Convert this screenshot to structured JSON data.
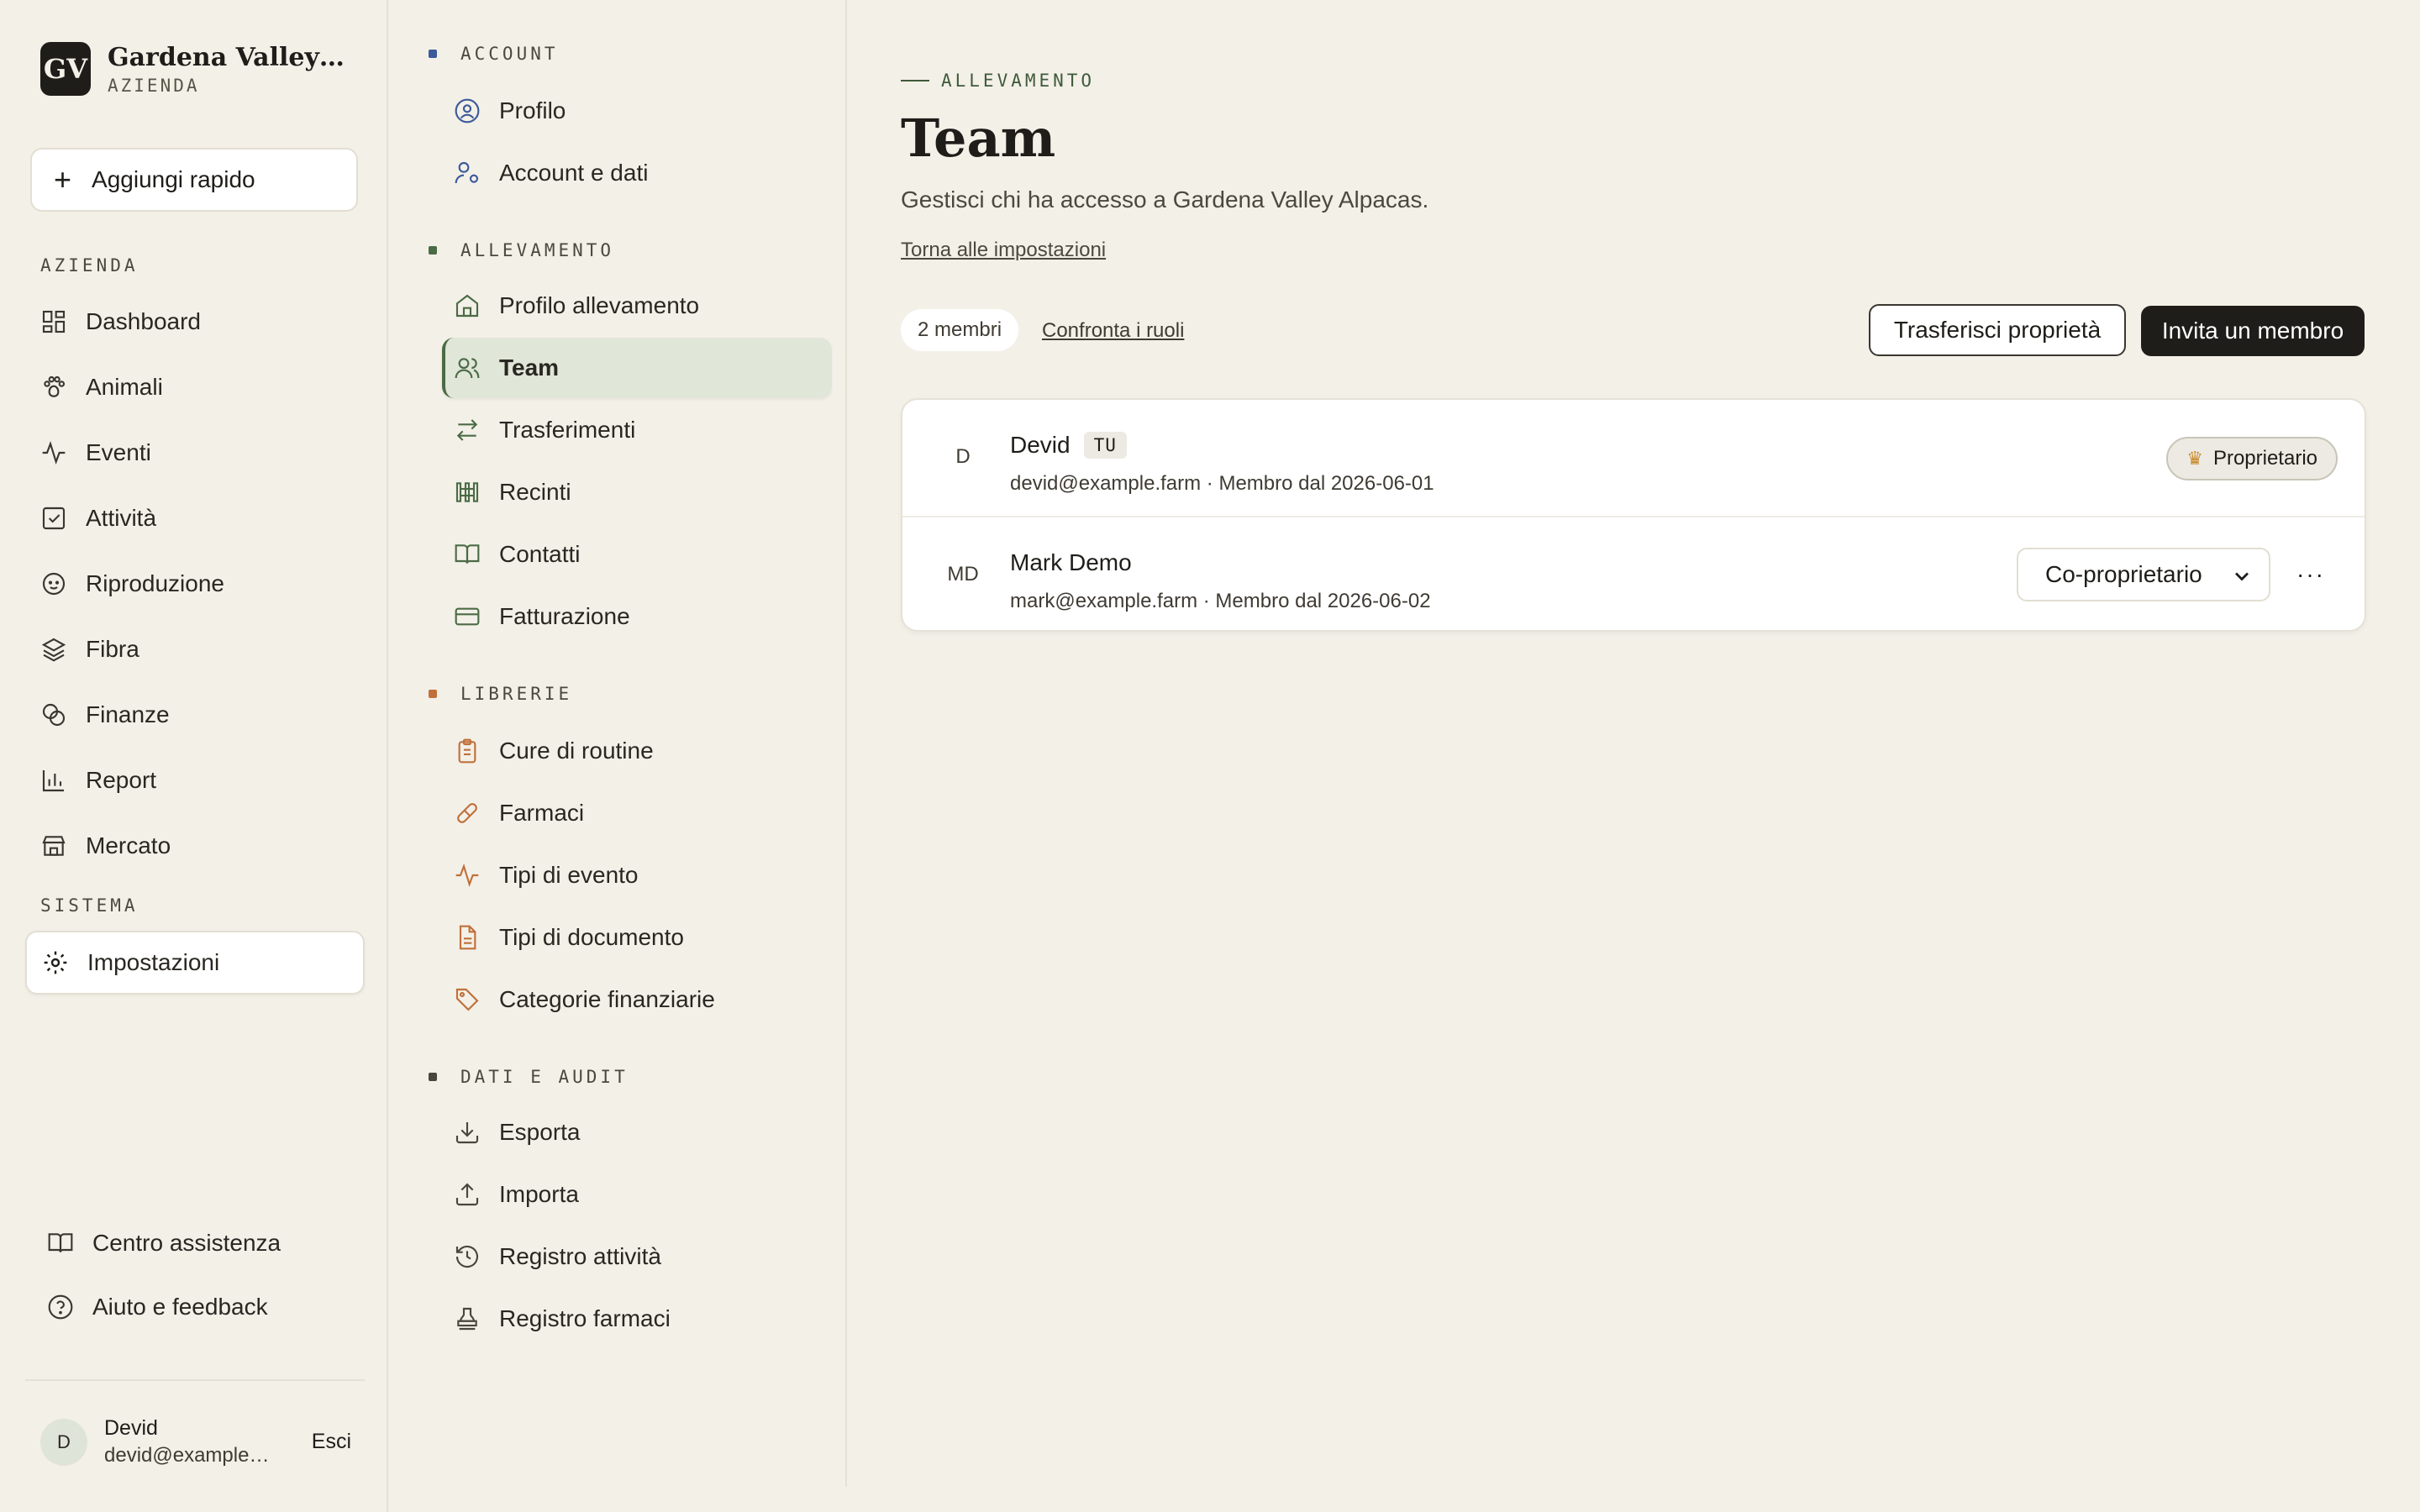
{
  "brand": {
    "logo": "GV",
    "name": "Gardena Valley Alpacas",
    "sub": "AZIENDA"
  },
  "quick_add": "Aggiungi rapido",
  "sidebar": {
    "section_azienda": "AZIENDA",
    "section_sistema": "SISTEMA",
    "items": [
      {
        "label": "Dashboard",
        "icon": "dashboard-icon"
      },
      {
        "label": "Animali",
        "icon": "paw-icon"
      },
      {
        "label": "Eventi",
        "icon": "activity-icon"
      },
      {
        "label": "Attività",
        "icon": "checkbox-icon"
      },
      {
        "label": "Riproduzione",
        "icon": "baby-icon"
      },
      {
        "label": "Fibra",
        "icon": "layers-icon"
      },
      {
        "label": "Finanze",
        "icon": "coins-icon"
      },
      {
        "label": "Report",
        "icon": "bar-chart-icon"
      },
      {
        "label": "Mercato",
        "icon": "store-icon"
      }
    ],
    "settings": "Impostazioni",
    "help_center": "Centro assistenza",
    "feedback": "Aiuto e feedback",
    "user": {
      "initial": "D",
      "name": "Devid",
      "email": "devid@example.farm",
      "logout": "Esci"
    }
  },
  "settings_nav": {
    "sections": [
      {
        "title": "ACCOUNT",
        "color": "#3d5a99"
      },
      {
        "title": "ALLEVAMENTO",
        "color": "#4b6b45"
      },
      {
        "title": "LIBRERIE",
        "color": "#c0703a"
      },
      {
        "title": "DATI E AUDIT",
        "color": "#4a463e"
      }
    ],
    "account": [
      "Profilo",
      "Account e dati"
    ],
    "allevamento": [
      "Profilo allevamento",
      "Team",
      "Trasferimenti",
      "Recinti",
      "Contatti",
      "Fatturazione"
    ],
    "librerie": [
      "Cure di routine",
      "Farmaci",
      "Tipi di evento",
      "Tipi di documento",
      "Categorie finanziarie"
    ],
    "dati": [
      "Esporta",
      "Importa",
      "Registro attività",
      "Registro farmaci"
    ]
  },
  "main": {
    "eyebrow": "ALLEVAMENTO",
    "title": "Team",
    "description": "Gestisci chi ha accesso a Gardena Valley Alpacas.",
    "back_link": "Torna alle impostazioni",
    "count": "2 membri",
    "compare": "Confronta i ruoli",
    "transfer": "Trasferisci proprietà",
    "invite": "Invita un membro",
    "members": [
      {
        "initials": "D",
        "name": "Devid",
        "badge": "TU",
        "meta": "devid@example.farm · Membro dal 2026-06-01",
        "role": "Proprietario"
      },
      {
        "initials": "MD",
        "name": "Mark Demo",
        "meta": "mark@example.farm · Membro dal 2026-06-02",
        "role": "Co-proprietario",
        "more": "···"
      }
    ]
  }
}
